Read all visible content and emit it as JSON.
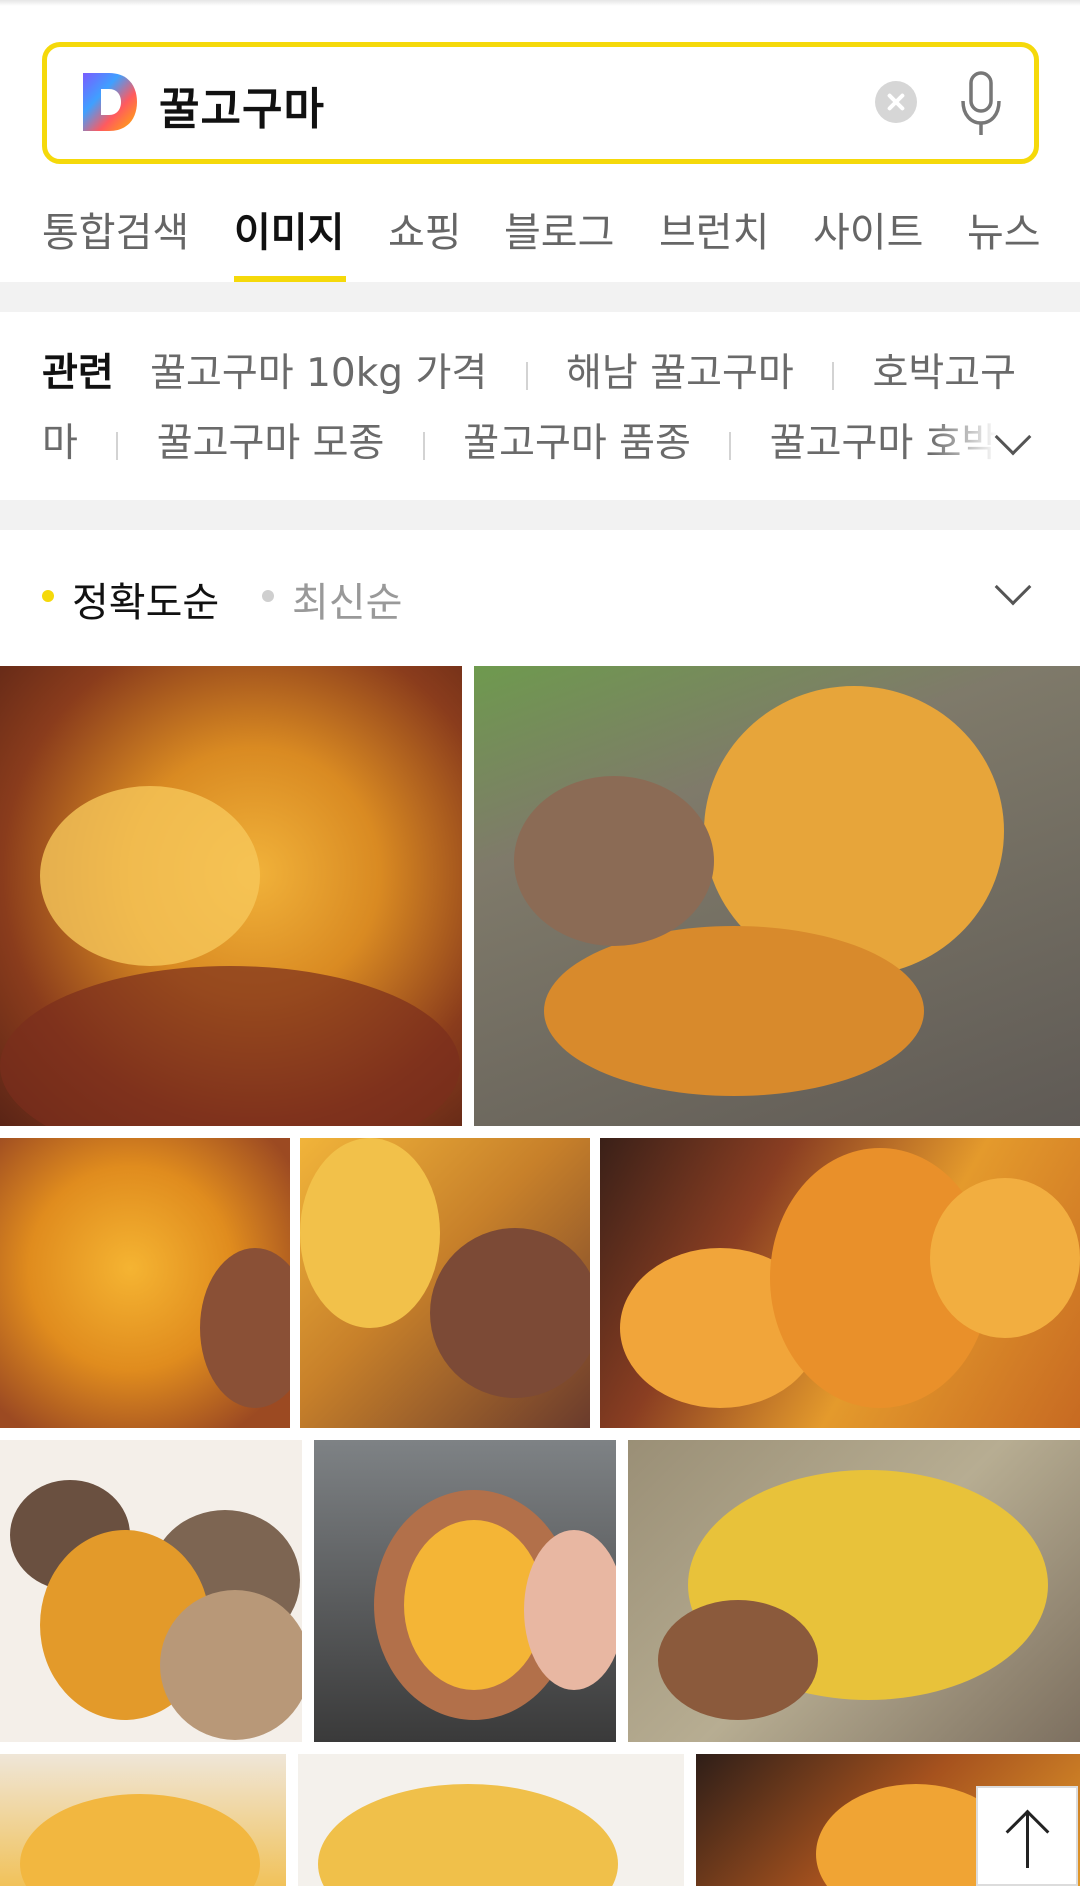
{
  "search": {
    "query": "꿀고구마",
    "logo_letter": "D",
    "clear_icon": "clear-icon",
    "mic_icon": "microphone-icon"
  },
  "tabs": [
    {
      "label": "통합검색",
      "active": false
    },
    {
      "label": "이미지",
      "active": true
    },
    {
      "label": "쇼핑",
      "active": false
    },
    {
      "label": "블로그",
      "active": false
    },
    {
      "label": "브런치",
      "active": false
    },
    {
      "label": "사이트",
      "active": false
    },
    {
      "label": "뉴스",
      "active": false
    }
  ],
  "related": {
    "label": "관련",
    "items": [
      "꿀고구마 10kg 가격",
      "해남 꿀고구마",
      "호박고구",
      "마",
      "꿀고구마 모종",
      "꿀고구마 품종",
      "꿀고구마 호박고"
    ],
    "expand_icon": "chevron-down-icon"
  },
  "sort": {
    "options": [
      {
        "label": "정확도순",
        "active": true
      },
      {
        "label": "최신순",
        "active": false
      }
    ],
    "expand_icon": "chevron-down-icon"
  },
  "colors": {
    "accent": "#f5d90a",
    "active_text": "#111111",
    "inactive_text": "#666666",
    "separator": "#f2f2f2"
  },
  "scroll_top_icon": "arrow-up-icon"
}
